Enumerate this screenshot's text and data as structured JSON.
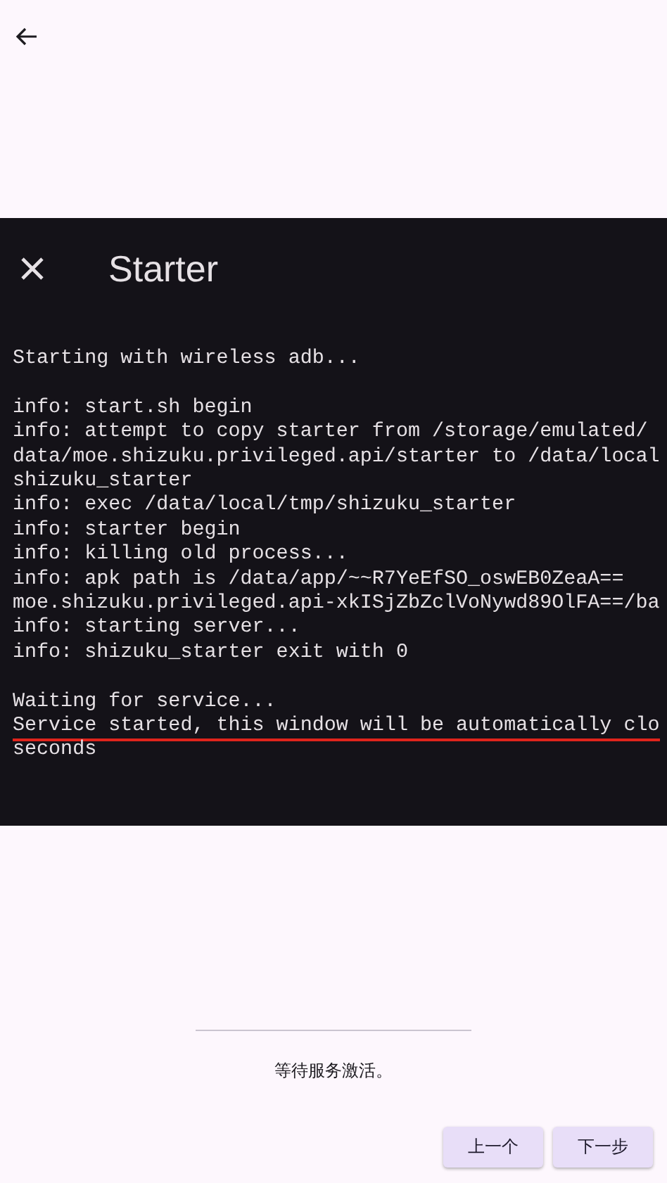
{
  "dialog": {
    "title": "Starter",
    "log_blocks": [
      [
        {
          "text": "Starting with wireless adb...",
          "underlined": false
        }
      ],
      [
        {
          "text": "info: start.sh begin",
          "underlined": false
        },
        {
          "text": "info: attempt to copy starter from /storage/emulated/",
          "underlined": false
        },
        {
          "text": "data/moe.shizuku.privileged.api/starter to /data/local",
          "underlined": false
        },
        {
          "text": "shizuku_starter",
          "underlined": false
        },
        {
          "text": "info: exec /data/local/tmp/shizuku_starter",
          "underlined": false
        },
        {
          "text": "info: starter begin",
          "underlined": false
        },
        {
          "text": "info: killing old process...",
          "underlined": false
        },
        {
          "text": "info: apk path is /data/app/~~R7YeEfSO_oswEB0ZeaA==",
          "underlined": false
        },
        {
          "text": "moe.shizuku.privileged.api-xkISjZbZclVoNywd89OlFA==/ba",
          "underlined": false
        },
        {
          "text": "info: starting server...",
          "underlined": false
        },
        {
          "text": "info: shizuku_starter exit with 0",
          "underlined": false
        }
      ],
      [
        {
          "text": "Waiting for service...",
          "underlined": false
        },
        {
          "text": "Service started, this window will be automatically clo",
          "underlined": true
        },
        {
          "text": "seconds",
          "underlined": false
        }
      ]
    ]
  },
  "status_text": "等待服务激活。",
  "buttons": [
    "上一个",
    "下一步"
  ]
}
